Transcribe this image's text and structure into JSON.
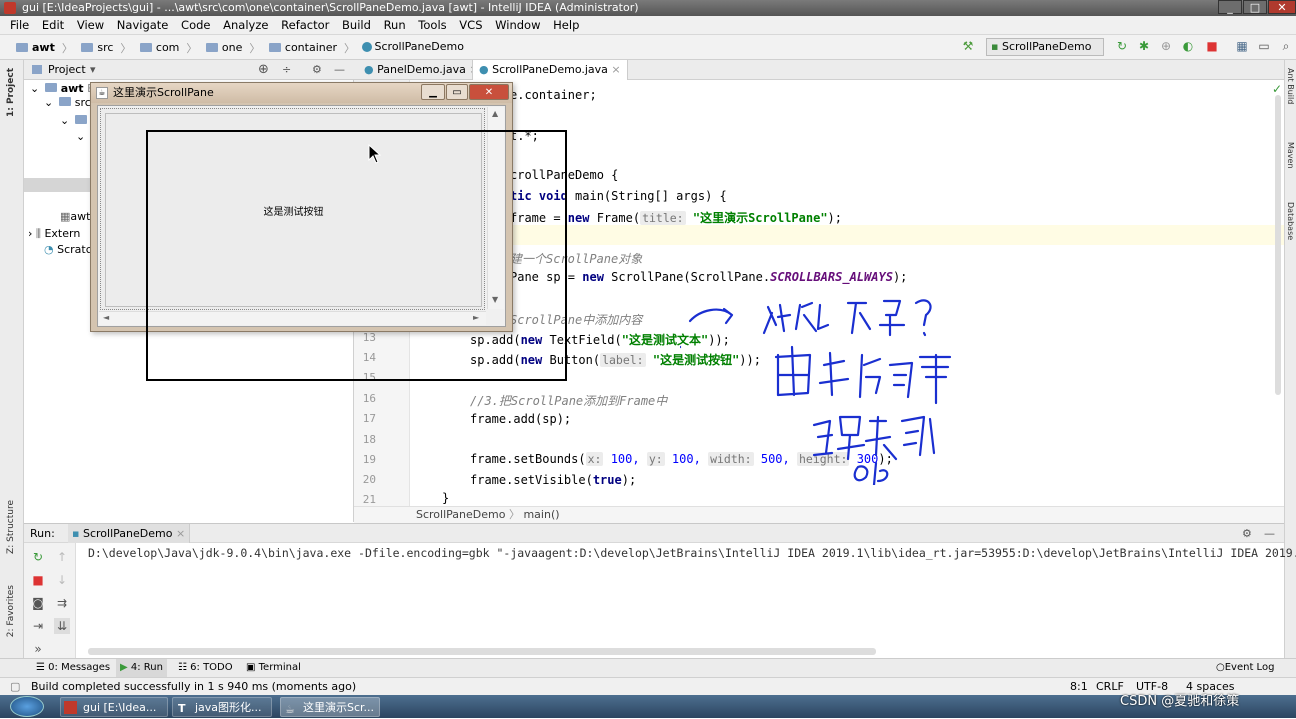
{
  "window": {
    "title": "gui [E:\\IdeaProjects\\gui] - ...\\awt\\src\\com\\one\\container\\ScrollPaneDemo.java [awt] - IntelliJ IDEA (Administrator)",
    "controls": [
      "_",
      "□",
      "✕"
    ]
  },
  "menu": [
    "File",
    "Edit",
    "View",
    "Navigate",
    "Code",
    "Analyze",
    "Refactor",
    "Build",
    "Run",
    "Tools",
    "VCS",
    "Window",
    "Help"
  ],
  "breadcrumb": [
    "awt",
    "src",
    "com",
    "one",
    "container",
    "ScrollPaneDemo"
  ],
  "run_config": "ScrollPaneDemo",
  "project_panel": {
    "title": "Project",
    "tree": [
      {
        "label": "awt",
        "extra": "E",
        "bold": true
      },
      {
        "label": "src"
      },
      {
        "label": ""
      },
      {
        "label": ""
      },
      {
        "label": "awt"
      },
      {
        "label": "Extern"
      },
      {
        "label": "Scratc"
      }
    ]
  },
  "editor": {
    "tabs": [
      {
        "label": "PanelDemo.java",
        "active": false
      },
      {
        "label": "ScrollPaneDemo.java",
        "active": true
      }
    ],
    "line_numbers": [
      "13",
      "14",
      "15",
      "16",
      "17",
      "18",
      "19",
      "20",
      "21"
    ],
    "code": {
      "l1": "e.container;",
      "l2": "t.*;",
      "l3a": "crollPaneDemo {",
      "l4_kw": "tic void",
      "l4_rest": " main(String[] args) {",
      "l5a": "frame = ",
      "l5_new": "new",
      "l5b": " Frame(",
      "l5_hint": "title:",
      "l5_str": "\"这里演示ScrollPane\"",
      "l5c": ");",
      "l6_cm": "建一个ScrollPane对象",
      "l7a": "Pane sp = ",
      "l7_new": "new",
      "l7b": " ScrollPane(ScrollPane.",
      "l7_const": "SCROLLBARS_ALWAYS",
      "l7c": ");",
      "l8_cm": "ScrollPane中添加内容",
      "l13a": "sp.add(",
      "l13_new": "new",
      "l13b": " TextField(",
      "l13_str": "\"这是测试文本\"",
      "l13c": "));",
      "l14a": "sp.add(",
      "l14_new": "new",
      "l14b": " Button(",
      "l14_hint": "label:",
      "l14_str": "\"这是测试按钮\"",
      "l14c": "));",
      "l16_cm": "//3.把ScrollPane添加到Frame中",
      "l17": "frame.add(sp);",
      "l19a": "frame.setBounds(",
      "l19_h1": "x:",
      "l19_v1": "100,",
      "l19_h2": "y:",
      "l19_v2": "100,",
      "l19_h3": "width:",
      "l19_v3": "500,",
      "l19_h4": "height:",
      "l19_v4": "300",
      "l19b": ");",
      "l20a": "frame.setVisible(",
      "l20_kw": "true",
      "l20b": ");",
      "l21": "}"
    },
    "status_crumb": [
      "ScrollPaneDemo",
      "main()"
    ]
  },
  "run_panel": {
    "label": "Run:",
    "tab": "ScrollPaneDemo",
    "console": "D:\\develop\\Java\\jdk-9.0.4\\bin\\java.exe -Dfile.encoding=gbk \"-javaagent:D:\\develop\\JetBrains\\IntelliJ IDEA 2019.1\\lib\\idea_rt.jar=53955:D:\\develop\\JetBrains\\IntelliJ IDEA 2019.1\\"
  },
  "tool_tabs": [
    "0: Messages",
    "4: Run",
    "6: TODO",
    "Terminal"
  ],
  "event_log": "Event Log",
  "left_strip": [
    "1: Project",
    "Z: Structure",
    "2: Favorites"
  ],
  "right_strip": [
    "Ant Build",
    "Maven",
    "Database"
  ],
  "status_bar": {
    "message": "Build completed successfully in 1 s 940 ms (moments ago)",
    "position": "8:1",
    "line_sep": "CRLF",
    "encoding": "UTF-8",
    "indent": "4 spaces"
  },
  "taskbar": [
    "gui [E:\\Idea...",
    "java图形化...",
    "这里演示Scr..."
  ],
  "frame_window": {
    "title": "这里演示ScrollPane",
    "button_label": "这是测试按钮"
  },
  "watermark": "CSDN @夏驰和徐策"
}
